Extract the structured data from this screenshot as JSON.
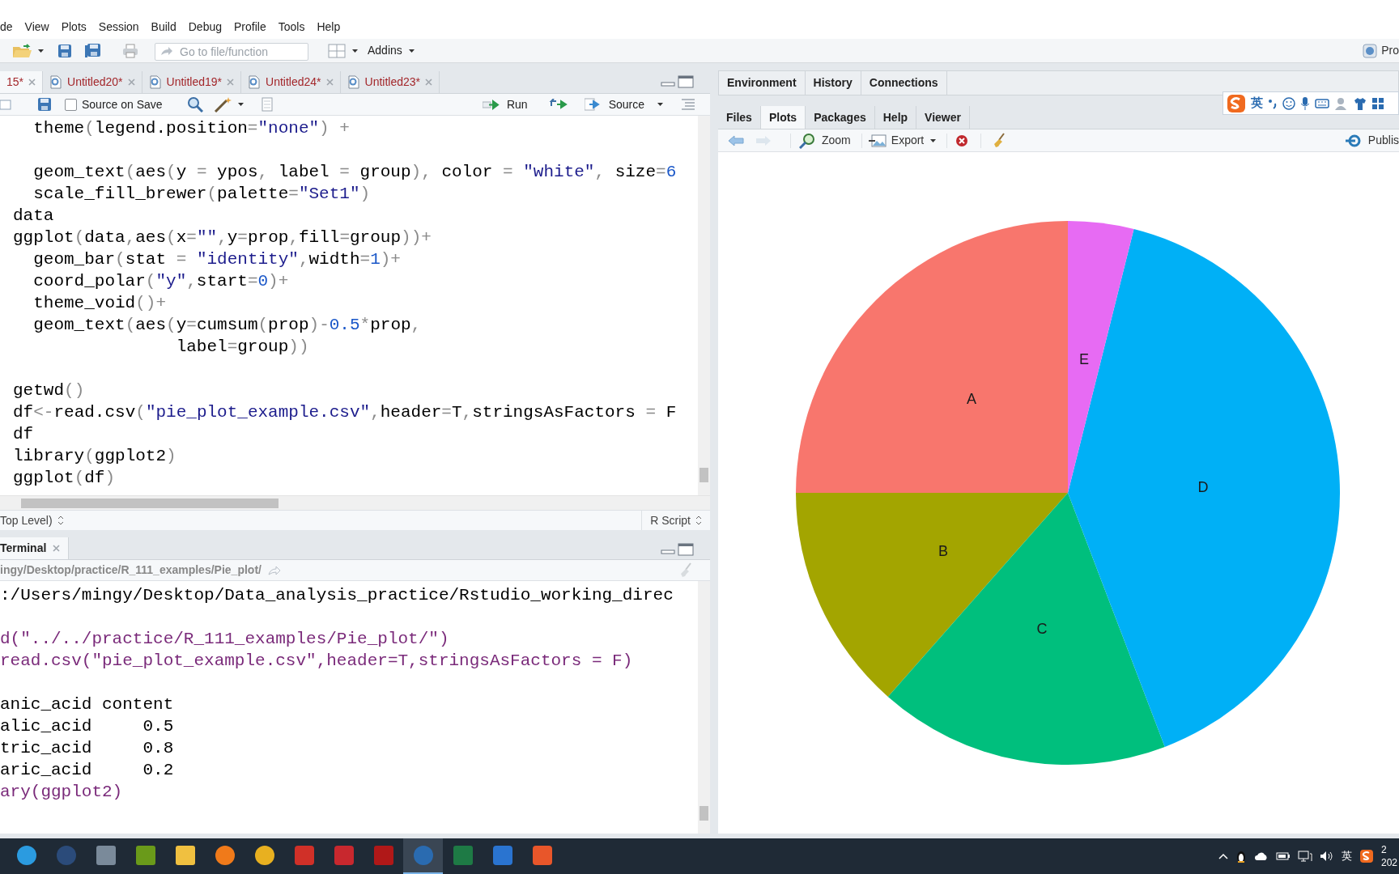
{
  "menu": [
    "de",
    "View",
    "Plots",
    "Session",
    "Build",
    "Debug",
    "Profile",
    "Tools",
    "Help"
  ],
  "toolbar": {
    "goto_placeholder": "Go to file/function",
    "addins": "Addins",
    "project": "Pro"
  },
  "editor": {
    "tabs": [
      {
        "label": "15*",
        "selected": true
      },
      {
        "label": "Untitled20*",
        "selected": false
      },
      {
        "label": "Untitled19*",
        "selected": false
      },
      {
        "label": "Untitled24*",
        "selected": false
      },
      {
        "label": "Untitled23*",
        "selected": false
      }
    ],
    "source_on_save": {
      "label": "Source on Save",
      "checked": false
    },
    "run": "Run",
    "source": "Source",
    "lines": [
      {
        "kind": "code",
        "text": "  theme(legend.position=\"none\") +"
      },
      {
        "kind": "blank"
      },
      {
        "kind": "code",
        "text": "  geom_text(aes(y = ypos, label = group), color = \"white\", size=6"
      },
      {
        "kind": "code",
        "text": "  scale_fill_brewer(palette=\"Set1\")"
      },
      {
        "kind": "code",
        "text": "data"
      },
      {
        "kind": "code",
        "text": "ggplot(data,aes(x=\"\",y=prop,fill=group))+"
      },
      {
        "kind": "code",
        "text": "  geom_bar(stat = \"identity\",width=1)+"
      },
      {
        "kind": "code",
        "text": "  coord_polar(\"y\",start=0)+"
      },
      {
        "kind": "code",
        "text": "  theme_void()+"
      },
      {
        "kind": "code",
        "text": "  geom_text(aes(y=cumsum(prop)-0.5*prop,"
      },
      {
        "kind": "code",
        "text": "                label=group))"
      },
      {
        "kind": "blank"
      },
      {
        "kind": "code",
        "text": "getwd()"
      },
      {
        "kind": "code",
        "text": "df<-read.csv(\"pie_plot_example.csv\",header=T,stringsAsFactors = F"
      },
      {
        "kind": "code",
        "text": "df"
      },
      {
        "kind": "code",
        "text": "library(ggplot2)"
      },
      {
        "kind": "code",
        "text": "ggplot(df)"
      }
    ],
    "status_left": "Top Level)",
    "status_right": "R Script"
  },
  "console": {
    "tab": "Terminal",
    "path": "ingy/Desktop/practice/R_111_examples/Pie_plot/",
    "lines": [
      {
        "kind": "output",
        "text": ":/Users/mingy/Desktop/Data_analysis_practice/Rstudio_working_direc"
      },
      {
        "kind": "blank"
      },
      {
        "kind": "input",
        "text": "d(\"../../practice/R_111_examples/Pie_plot/\")"
      },
      {
        "kind": "input",
        "text": "read.csv(\"pie_plot_example.csv\",header=T,stringsAsFactors = F)"
      },
      {
        "kind": "blank"
      },
      {
        "kind": "output",
        "text": "anic_acid content"
      },
      {
        "kind": "output",
        "text": "alic_acid     0.5"
      },
      {
        "kind": "output",
        "text": "tric_acid     0.8"
      },
      {
        "kind": "output",
        "text": "aric_acid     0.2"
      },
      {
        "kind": "input",
        "text": "ary(ggplot2)"
      }
    ]
  },
  "right_top_tabs": [
    {
      "label": "Environment"
    },
    {
      "label": "History"
    },
    {
      "label": "Connections"
    }
  ],
  "right_tabs": [
    {
      "label": "Files",
      "selected": false
    },
    {
      "label": "Plots",
      "selected": true
    },
    {
      "label": "Packages",
      "selected": false
    },
    {
      "label": "Help",
      "selected": false
    },
    {
      "label": "Viewer",
      "selected": false
    }
  ],
  "plots_toolbar": {
    "zoom": "Zoom",
    "export": "Export",
    "publish": "Publis"
  },
  "plot": {
    "slices": [
      {
        "label": "A",
        "color": "#f8766d"
      },
      {
        "label": "B",
        "color": "#a3a500"
      },
      {
        "label": "C",
        "color": "#00bf7d"
      },
      {
        "label": "D",
        "color": "#00b0f6"
      },
      {
        "label": "E",
        "color": "#e76bf3"
      }
    ]
  },
  "ime": {
    "lang": "英"
  },
  "taskbar": {
    "apps": [
      {
        "selected": false
      },
      {
        "selected": false
      },
      {
        "selected": false
      },
      {
        "selected": false
      },
      {
        "selected": false
      },
      {
        "selected": false
      },
      {
        "selected": false
      },
      {
        "selected": false
      },
      {
        "selected": false
      },
      {
        "selected": false
      },
      {
        "selected": true
      },
      {
        "selected": false
      },
      {
        "selected": false
      },
      {
        "selected": false
      }
    ],
    "tray_lang": "英",
    "clock": [
      "2",
      "202"
    ]
  }
}
